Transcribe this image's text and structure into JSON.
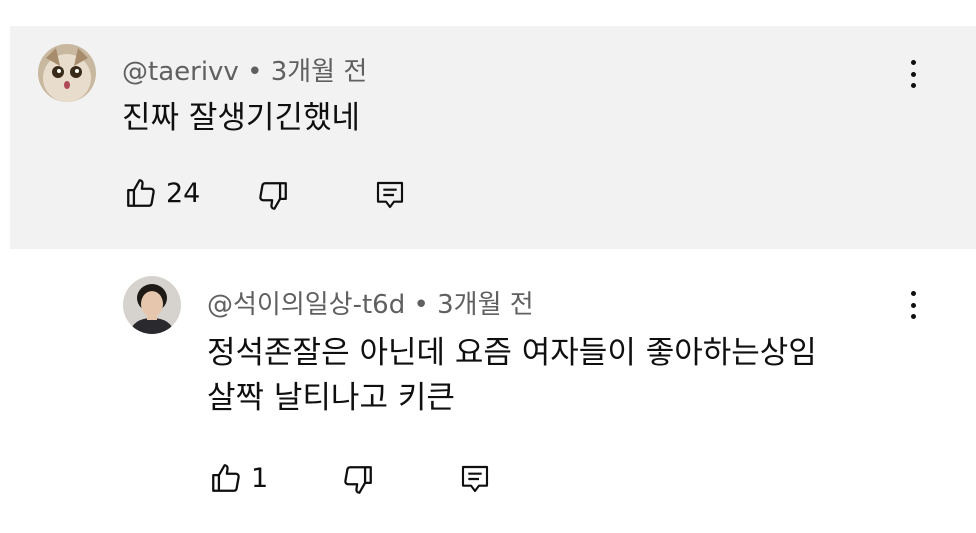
{
  "comments": [
    {
      "author": "@taerivv",
      "separator": "•",
      "time": "3개월 전",
      "lines": [
        "진짜 잘생기긴했네"
      ],
      "likes": "24",
      "avatar_icon": "cat-avatar-icon"
    },
    {
      "author": "@석이의일상-t6d",
      "separator": "•",
      "time": "3개월 전",
      "lines": [
        "정석존잘은 아닌데 요즘 여자들이 좋아하는상임",
        "살짝 날티나고 키큰"
      ],
      "likes": "1",
      "avatar_icon": "person-avatar-icon"
    }
  ],
  "colors": {
    "highlight_bg": "#f2f2f2",
    "meta_text": "#606060",
    "primary_text": "#0f0f0f"
  }
}
